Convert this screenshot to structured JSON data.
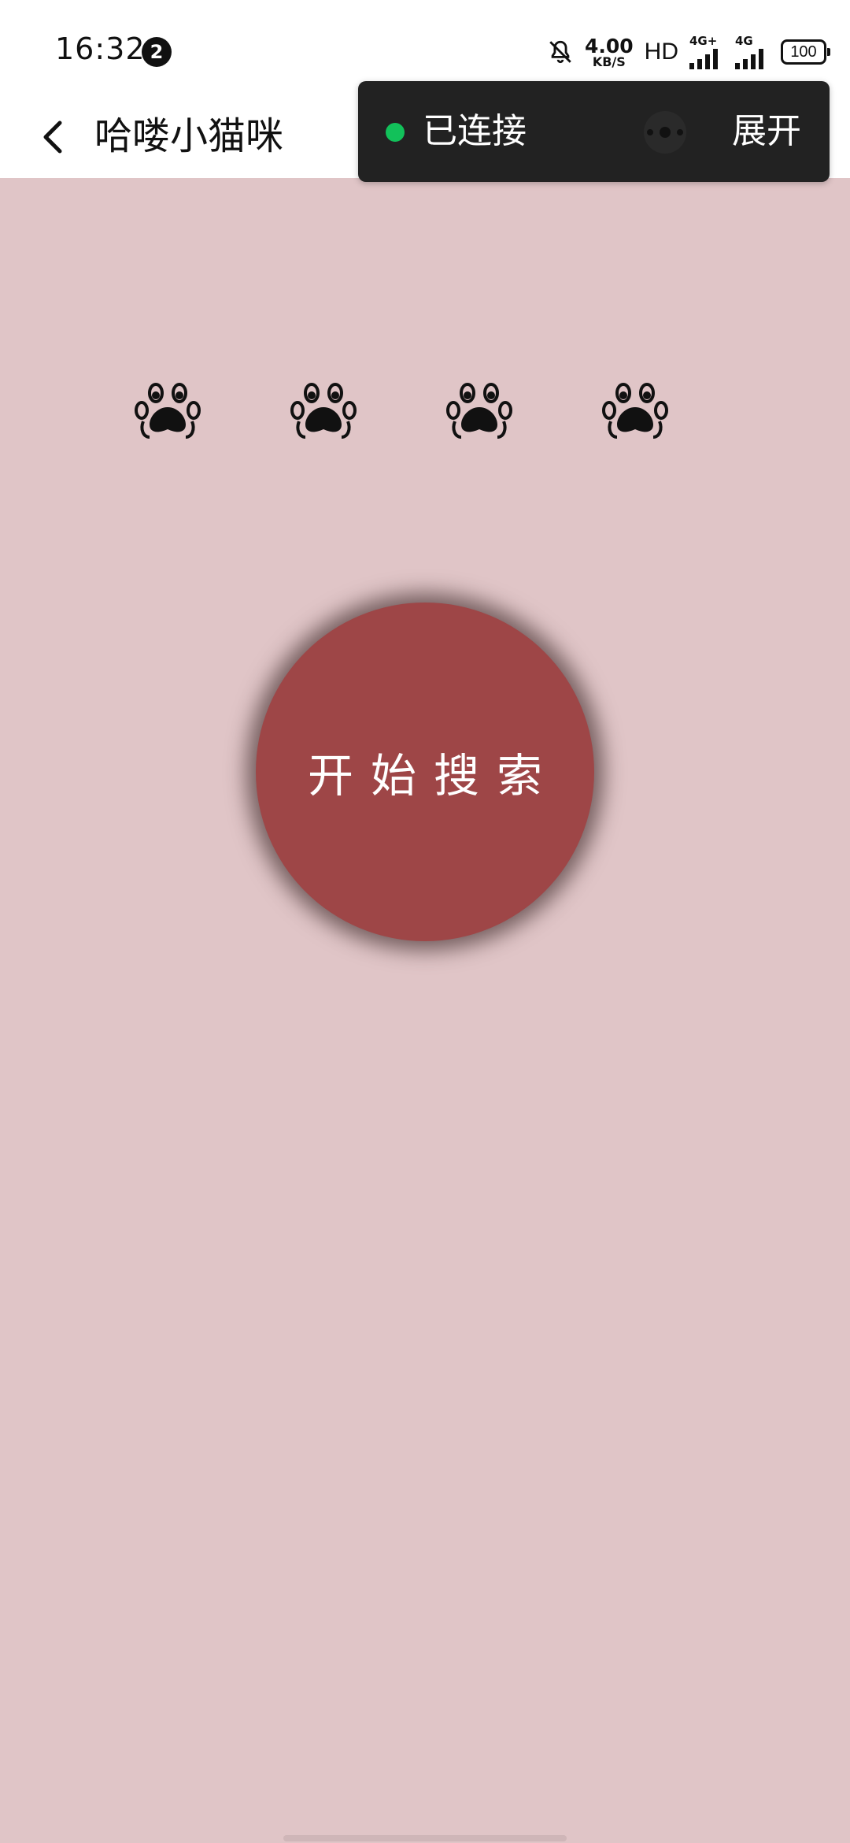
{
  "status_bar": {
    "time": "16:32",
    "notification_count": "2",
    "net_speed_value": "4.00",
    "net_speed_unit": "KB/S",
    "hd_label": "HD",
    "sim1_label": "4G+",
    "sim2_label": "4G",
    "battery": "100"
  },
  "header": {
    "title": "哈喽小猫咪"
  },
  "capsule": {
    "status_label": "已连接",
    "status_color": "#12c15a",
    "expand_label": "展开"
  },
  "paws": [
    "paw-icon",
    "paw-icon",
    "paw-icon",
    "paw-icon"
  ],
  "main": {
    "search_button_label": "开始搜索",
    "search_button_color": "#9e4647",
    "background_color": "#e0c5c7"
  }
}
